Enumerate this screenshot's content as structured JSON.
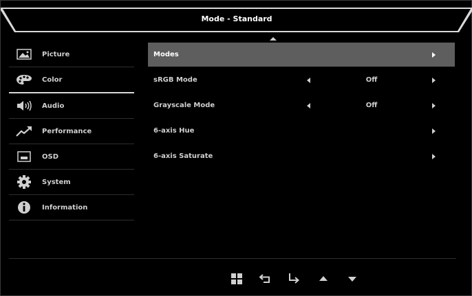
{
  "header": {
    "title": "Mode - Standard"
  },
  "sidebar": {
    "items": [
      {
        "label": "Picture",
        "icon": "picture-icon"
      },
      {
        "label": "Color",
        "icon": "palette-icon",
        "active": true
      },
      {
        "label": "Audio",
        "icon": "speaker-icon"
      },
      {
        "label": "Performance",
        "icon": "trend-up-icon"
      },
      {
        "label": "OSD",
        "icon": "osd-window-icon"
      },
      {
        "label": "System",
        "icon": "gear-icon"
      },
      {
        "label": "Information",
        "icon": "info-icon"
      }
    ]
  },
  "content": {
    "rows": [
      {
        "label": "Modes",
        "value": "",
        "selected": true
      },
      {
        "label": "sRGB Mode",
        "value": "Off"
      },
      {
        "label": "Grayscale Mode",
        "value": "Off"
      },
      {
        "label": "6-axis Hue",
        "value": ""
      },
      {
        "label": "6-axis Saturate",
        "value": ""
      }
    ]
  },
  "footer": {
    "buttons": [
      "menu-grid-icon",
      "back-icon",
      "enter-icon",
      "up-icon",
      "down-icon"
    ]
  },
  "colors": {
    "background": "#000000",
    "selected_row": "#5e5e5e",
    "text": "#cfcfcf",
    "header_band": "#d9d9d9"
  }
}
